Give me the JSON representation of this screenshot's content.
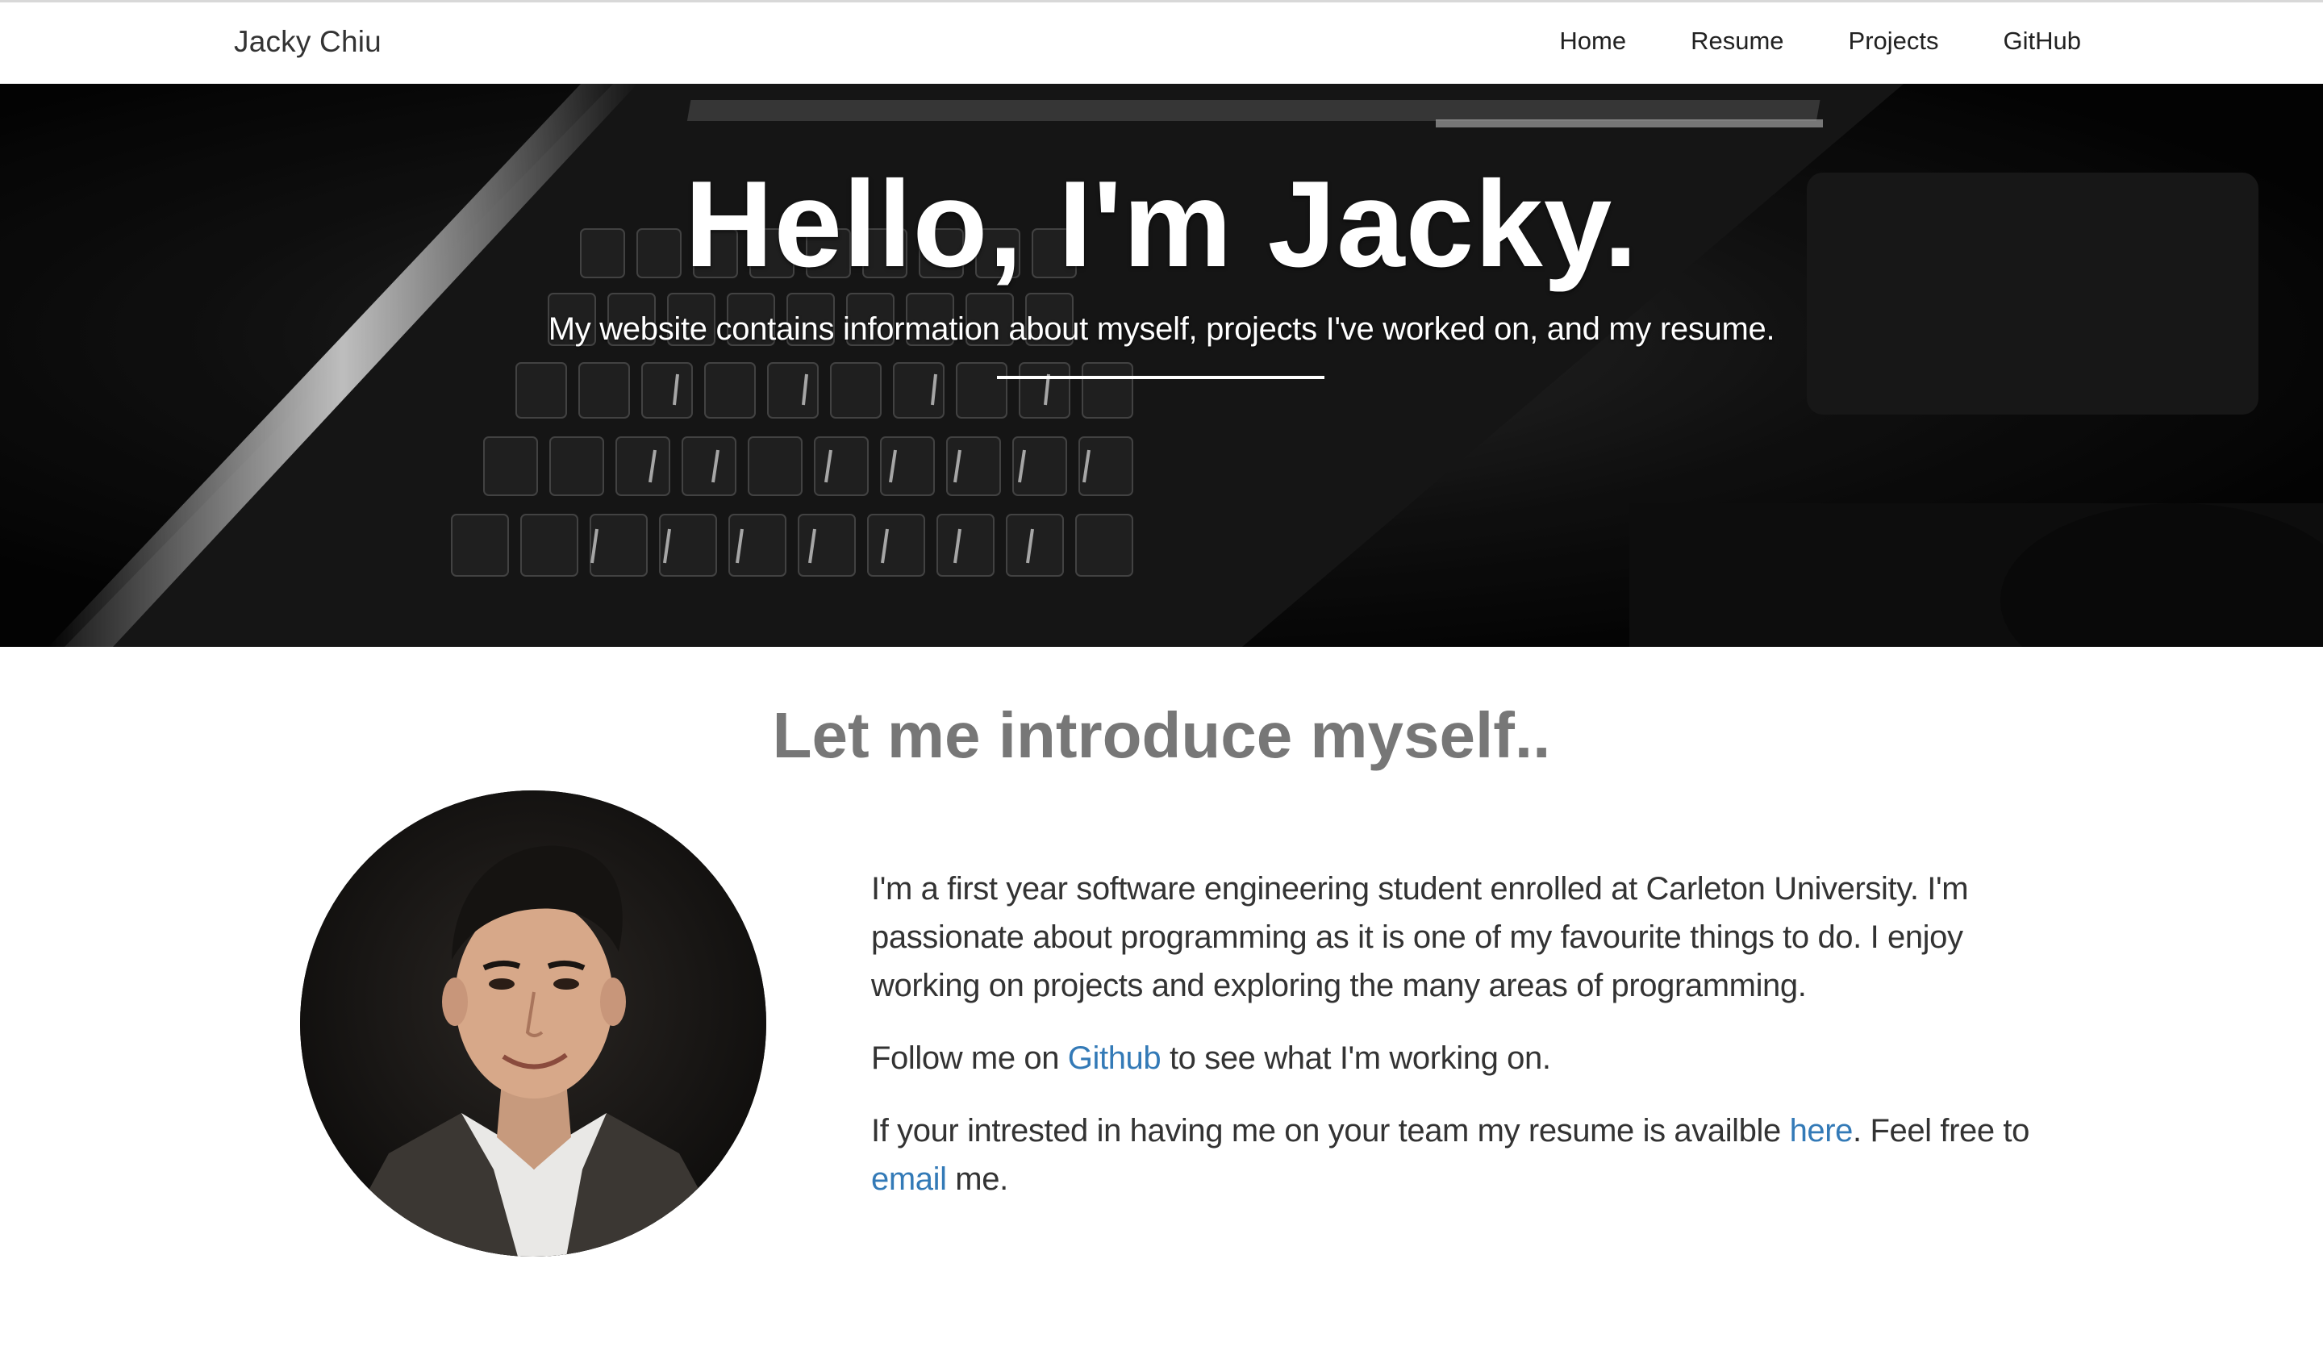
{
  "navbar": {
    "brand": "Jacky Chiu",
    "links": [
      "Home",
      "Resume",
      "Projects",
      "GitHub"
    ]
  },
  "hero": {
    "title": "Hello, I'm Jacky.",
    "subtitle": "My website contains information about myself, projects I've worked on, and my resume."
  },
  "intro": {
    "heading": "Let me introduce myself..",
    "paragraph1": "I'm a first year software engineering student enrolled at Carleton University. I'm passionate about programming as it is one of my favourite things to do. I enjoy working on projects and exploring the many areas of programming.",
    "paragraph2": {
      "before": "Follow me on ",
      "link": "Github",
      "after": " to see what I'm working on."
    },
    "paragraph3": {
      "before": "If your intrested in having me on your team my resume is availble ",
      "link1": "here",
      "middle": ". Feel free to ",
      "link2": "email",
      "after": " me."
    }
  },
  "colors": {
    "link": "#337ab7",
    "heading": "#777777",
    "text": "#333333"
  }
}
